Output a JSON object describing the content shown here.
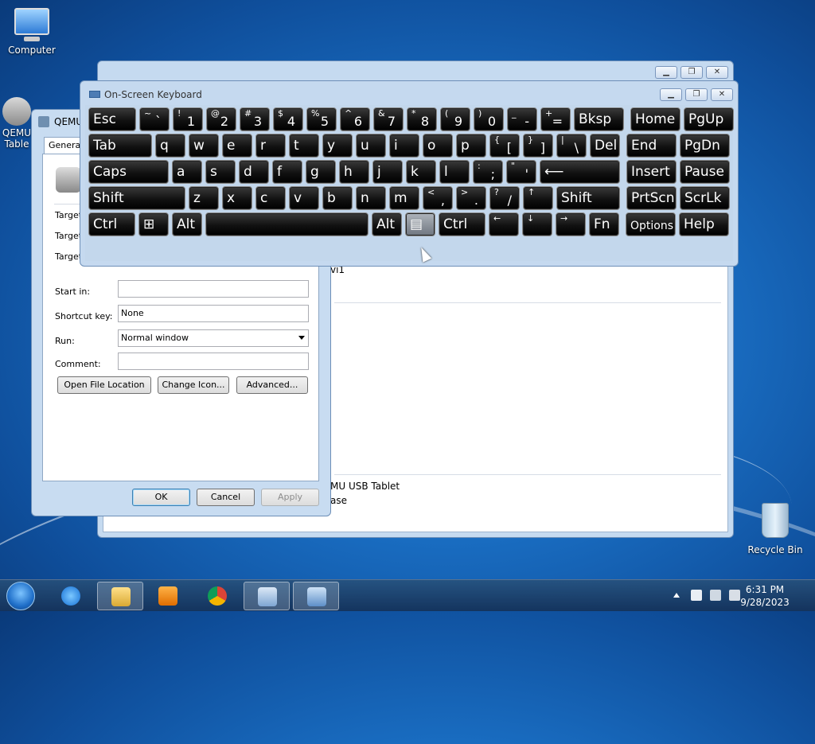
{
  "desktop": {
    "icons": [
      {
        "label": "Computer"
      },
      {
        "label": "QEMU"
      },
      {
        "label": "Table"
      },
      {
        "label": "Recycle Bin"
      }
    ]
  },
  "back_window": {
    "partial_text_1": "vi1",
    "partial_text_2": "MU USB Tablet",
    "partial_text_3": "ase"
  },
  "props_dialog": {
    "title": "QEMU",
    "tab": "General",
    "labels": {
      "target1": "Target",
      "target2": "Target",
      "target3": "Target",
      "start_in": "Start in:",
      "shortcut_key": "Shortcut key:",
      "run": "Run:",
      "comment": "Comment:"
    },
    "values": {
      "start_in": "",
      "shortcut_key": "None",
      "run": "Normal window",
      "comment": ""
    },
    "buttons": {
      "open_location": "Open File Location",
      "change_icon": "Change Icon...",
      "advanced": "Advanced...",
      "ok": "OK",
      "cancel": "Cancel",
      "apply": "Apply"
    }
  },
  "osk": {
    "title": "On-Screen Keyboard",
    "row1": [
      {
        "m": "Esc"
      },
      {
        "t": "~",
        "b": "`"
      },
      {
        "t": "!",
        "b": "1"
      },
      {
        "t": "@",
        "b": "2"
      },
      {
        "t": "#",
        "b": "3"
      },
      {
        "t": "$",
        "b": "4"
      },
      {
        "t": "%",
        "b": "5"
      },
      {
        "t": "^",
        "b": "6"
      },
      {
        "t": "&",
        "b": "7"
      },
      {
        "t": "*",
        "b": "8"
      },
      {
        "t": "(",
        "b": "9"
      },
      {
        "t": ")",
        "b": "0"
      },
      {
        "t": "_",
        "b": "-"
      },
      {
        "t": "+",
        "b": "="
      },
      {
        "m": "Bksp"
      },
      {
        "m": "Home"
      },
      {
        "m": "PgUp"
      }
    ],
    "row2": [
      {
        "m": "Tab"
      },
      {
        "m": "q"
      },
      {
        "m": "w"
      },
      {
        "m": "e"
      },
      {
        "m": "r"
      },
      {
        "m": "t"
      },
      {
        "m": "y"
      },
      {
        "m": "u"
      },
      {
        "m": "i"
      },
      {
        "m": "o"
      },
      {
        "m": "p"
      },
      {
        "t": "{",
        "b": "["
      },
      {
        "t": "}",
        "b": "]"
      },
      {
        "t": "|",
        "b": "\\"
      },
      {
        "m": "Del"
      },
      {
        "m": "End"
      },
      {
        "m": "PgDn"
      }
    ],
    "row3": [
      {
        "m": "Caps"
      },
      {
        "m": "a"
      },
      {
        "m": "s"
      },
      {
        "m": "d"
      },
      {
        "m": "f"
      },
      {
        "m": "g"
      },
      {
        "m": "h"
      },
      {
        "m": "j"
      },
      {
        "m": "k"
      },
      {
        "m": "l"
      },
      {
        "t": ":",
        "b": ";"
      },
      {
        "t": "\"",
        "b": "'"
      },
      {
        "m": "⟵"
      },
      {
        "m": "Insert"
      },
      {
        "m": "Pause"
      }
    ],
    "row4": [
      {
        "m": "Shift"
      },
      {
        "m": "z"
      },
      {
        "m": "x"
      },
      {
        "m": "c"
      },
      {
        "m": "v"
      },
      {
        "m": "b"
      },
      {
        "m": "n"
      },
      {
        "m": "m"
      },
      {
        "t": "<",
        "b": ","
      },
      {
        "t": ">",
        "b": "."
      },
      {
        "t": "?",
        "b": "/"
      },
      {
        "t": "↑"
      },
      {
        "m": "Shift"
      },
      {
        "m": "PrtScn"
      },
      {
        "m": "ScrLk"
      }
    ],
    "row5": [
      {
        "m": "Ctrl"
      },
      {
        "m": "⊞"
      },
      {
        "m": "Alt"
      },
      {
        "m": ""
      },
      {
        "m": "Alt"
      },
      {
        "m": "▤"
      },
      {
        "m": "Ctrl"
      },
      {
        "t": "←"
      },
      {
        "t": "↓"
      },
      {
        "t": "→"
      },
      {
        "m": "Fn"
      },
      {
        "m": "Options"
      },
      {
        "m": "Help"
      }
    ]
  },
  "taskbar": {
    "time": "6:31 PM",
    "date": "9/28/2023",
    "apps": [
      "internet-explorer",
      "file-explorer",
      "media-player",
      "chrome",
      "on-screen-keyboard",
      "control-panel"
    ]
  }
}
